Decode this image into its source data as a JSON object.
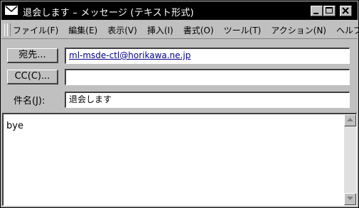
{
  "window": {
    "title": "退会します – メッセージ (テキスト形式)"
  },
  "menu": [
    "ファイル(F)",
    "編集(E)",
    "表示(V)",
    "挿入(I)",
    "書式(O)",
    "ツール(T)",
    "アクション(N)",
    "ヘルプ(H)"
  ],
  "fields": {
    "to_label": "宛先...",
    "to_value": "ml-msde-ctl@horikawa.ne.jp",
    "cc_label": "CC(C)...",
    "cc_value": "",
    "subject_label": "件名(J):",
    "subject_value": "退会します"
  },
  "body": {
    "text": "bye"
  }
}
